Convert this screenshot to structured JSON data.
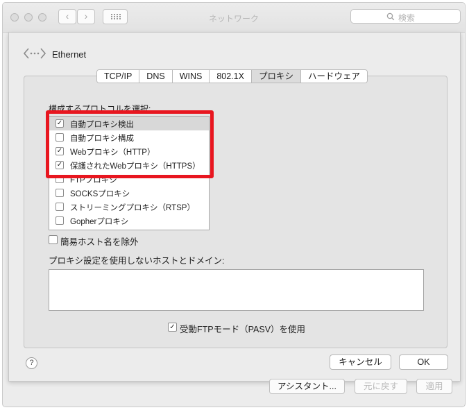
{
  "window": {
    "title": "ネットワーク"
  },
  "search": {
    "placeholder": "検索"
  },
  "interface": {
    "name": "Ethernet"
  },
  "tabs": [
    "TCP/IP",
    "DNS",
    "WINS",
    "802.1X",
    "プロキシ",
    "ハードウェア"
  ],
  "active_tab": "プロキシ",
  "proxy": {
    "protocol_label": "構成するプロトコルを選択:",
    "protocols": [
      {
        "label": "自動プロキシ検出",
        "checked": true,
        "selected": true
      },
      {
        "label": "自動プロキシ構成",
        "checked": false,
        "selected": false
      },
      {
        "label": "Webプロキシ（HTTP）",
        "checked": true,
        "selected": false
      },
      {
        "label": "保護されたWebプロキシ（HTTPS）",
        "checked": true,
        "selected": false
      },
      {
        "label": "FTPプロキシ",
        "checked": false,
        "selected": false
      },
      {
        "label": "SOCKSプロキシ",
        "checked": false,
        "selected": false
      },
      {
        "label": "ストリーミングプロキシ（RTSP）",
        "checked": false,
        "selected": false
      },
      {
        "label": "Gopherプロキシ",
        "checked": false,
        "selected": false
      }
    ],
    "exclude_simple_hostnames": "簡易ホスト名を除外",
    "bypass_label": "プロキシ設定を使用しないホストとドメイン:",
    "bypass_value": "",
    "passive_ftp": "受動FTPモード（PASV）を使用"
  },
  "buttons": {
    "cancel": "キャンセル",
    "ok": "OK",
    "help": "?",
    "assistant": "アシスタント...",
    "revert": "元に戻す",
    "apply": "適用"
  },
  "colors": {
    "highlight": "#e8161f",
    "window_bg": "#ececec"
  }
}
